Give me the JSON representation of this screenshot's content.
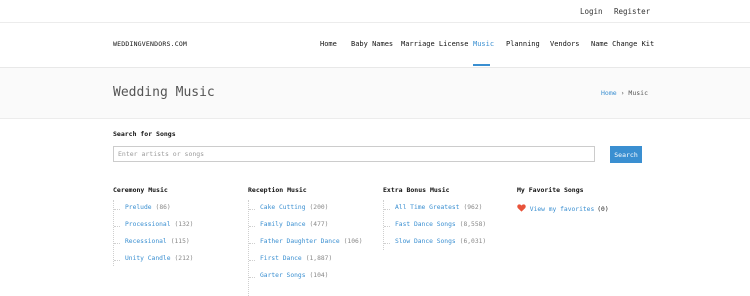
{
  "topbar": {
    "login": "Login",
    "register": "Register"
  },
  "header": {
    "logo": "WEDDINGVENDORS.COM",
    "nav": [
      "Home",
      "Baby Names",
      "Marriage License",
      "Music",
      "Planning",
      "Vendors",
      "Name Change Kit"
    ],
    "active_nav": "Music"
  },
  "titlebar": {
    "title": "Wedding Music",
    "breadcrumb_home": "Home",
    "breadcrumb_sep": "›",
    "breadcrumb_current": "Music"
  },
  "search": {
    "label": "Search for Songs",
    "placeholder": "Enter artists or songs",
    "button": "Search"
  },
  "columns": [
    {
      "title": "Ceremony Music",
      "items": [
        {
          "label": "Prelude",
          "count": "(86)"
        },
        {
          "label": "Processional",
          "count": "(132)"
        },
        {
          "label": "Recessional",
          "count": "(115)"
        },
        {
          "label": "Unity Candle",
          "count": "(212)"
        }
      ]
    },
    {
      "title": "Reception Music",
      "items": [
        {
          "label": "Cake Cutting",
          "count": "(200)"
        },
        {
          "label": "Family Dance",
          "count": "(477)"
        },
        {
          "label": "Father Daughter Dance",
          "count": "(106)"
        },
        {
          "label": "First Dance",
          "count": "(1,887)"
        },
        {
          "label": "Garter Songs",
          "count": "(104)"
        }
      ]
    },
    {
      "title": "Extra Bonus Music",
      "items": [
        {
          "label": "All Time Greatest",
          "count": "(962)"
        },
        {
          "label": "Fast Dance Songs",
          "count": "(8,558)"
        },
        {
          "label": "Slow Dance Songs",
          "count": "(6,031)"
        }
      ]
    }
  ],
  "favorites": {
    "title": "My Favorite Songs",
    "link": "View my favorites",
    "count": "(0)",
    "heart_color": "#e8533a"
  },
  "colors": {
    "accent": "#3a8fd1"
  }
}
